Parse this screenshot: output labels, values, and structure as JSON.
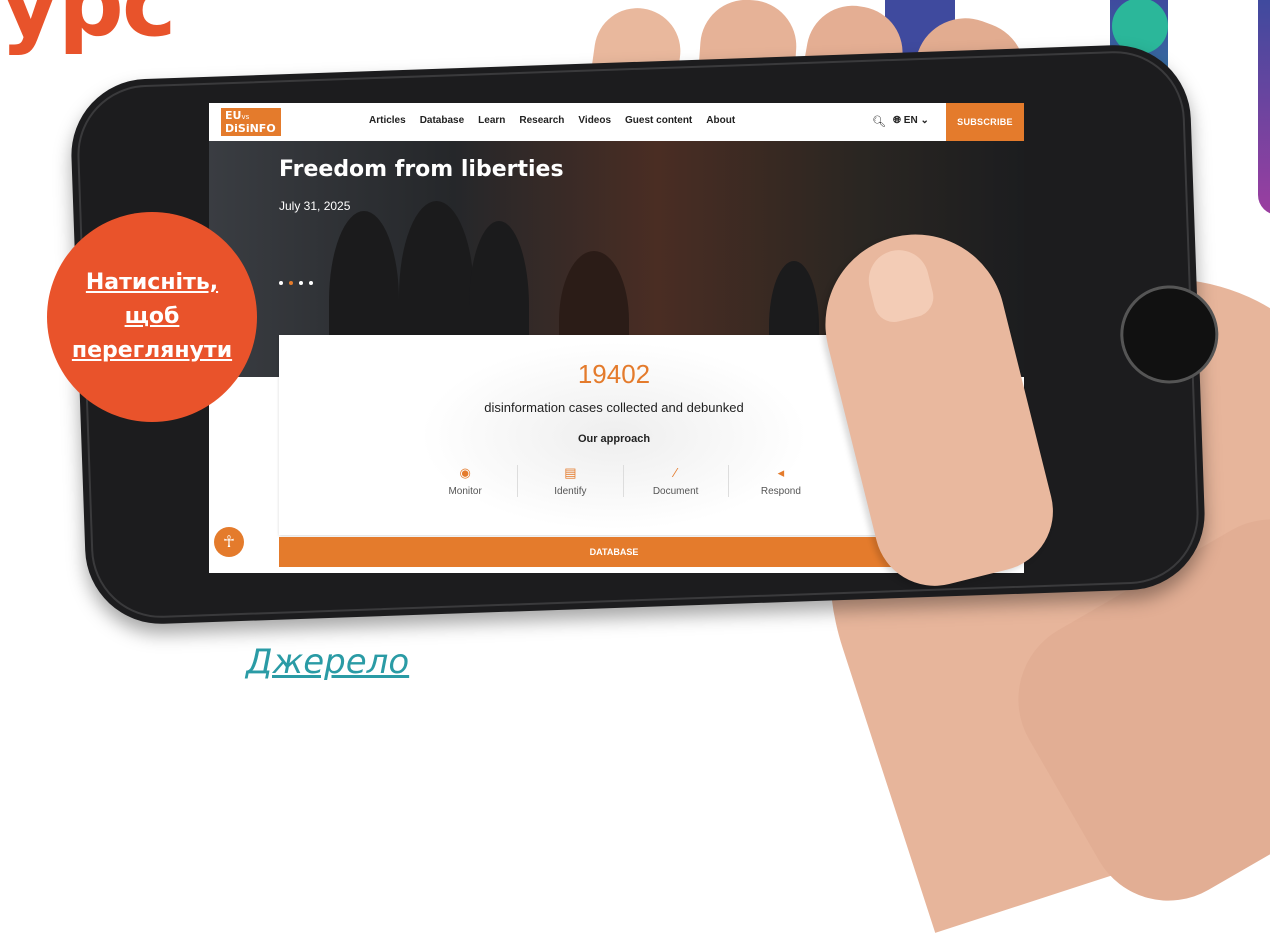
{
  "slide": {
    "heading_fragment": "урс",
    "cta_lines": [
      "Натисніть,",
      "щоб",
      "переглянути"
    ],
    "source_link": "Джерело"
  },
  "site": {
    "logo_line1": "EU",
    "logo_line2": "vs",
    "logo_line3": "DiSiNFO",
    "nav": [
      "Articles",
      "Database",
      "Learn",
      "Research",
      "Videos",
      "Guest content",
      "About"
    ],
    "language": "EN",
    "subscribe_label": "SUBSCRIBE",
    "hero": {
      "title": "Freedom from liberties",
      "date": "July 31, 2025"
    },
    "stats": {
      "count": "19402",
      "description": "disinformation cases collected and debunked",
      "approach_label": "Our approach",
      "steps": [
        "Monitor",
        "Identify",
        "Document",
        "Respond"
      ]
    },
    "database_label": "DATABASE"
  },
  "icons": {
    "search": "search-icon",
    "globe": "globe-icon",
    "monitor": "eye-icon",
    "identify": "id-card-icon",
    "document": "brush-icon",
    "respond": "megaphone-icon",
    "accessibility": "accessibility-icon"
  },
  "colors": {
    "accent": "#e47b2c",
    "cta": "#e9532b",
    "link": "#2a9ba5"
  }
}
